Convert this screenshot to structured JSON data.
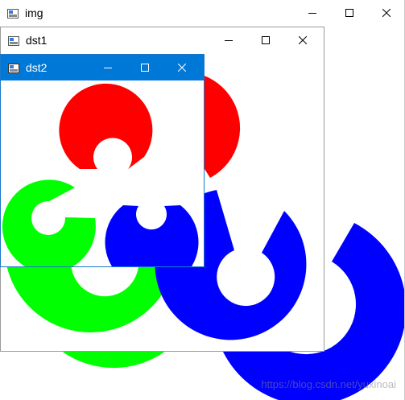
{
  "windows": {
    "img": {
      "title": "img"
    },
    "dst1": {
      "title": "dst1"
    },
    "dst2": {
      "title": "dst2"
    }
  },
  "controls": {
    "minimize": "minimize-icon",
    "maximize": "maximize-icon",
    "close": "close-icon"
  },
  "colors": {
    "red": "#ff0000",
    "green": "#00ff00",
    "blue": "#0000ff",
    "active_titlebar": "#0078d7"
  },
  "watermark": "https://blog.csdn.net/yuxinoai"
}
